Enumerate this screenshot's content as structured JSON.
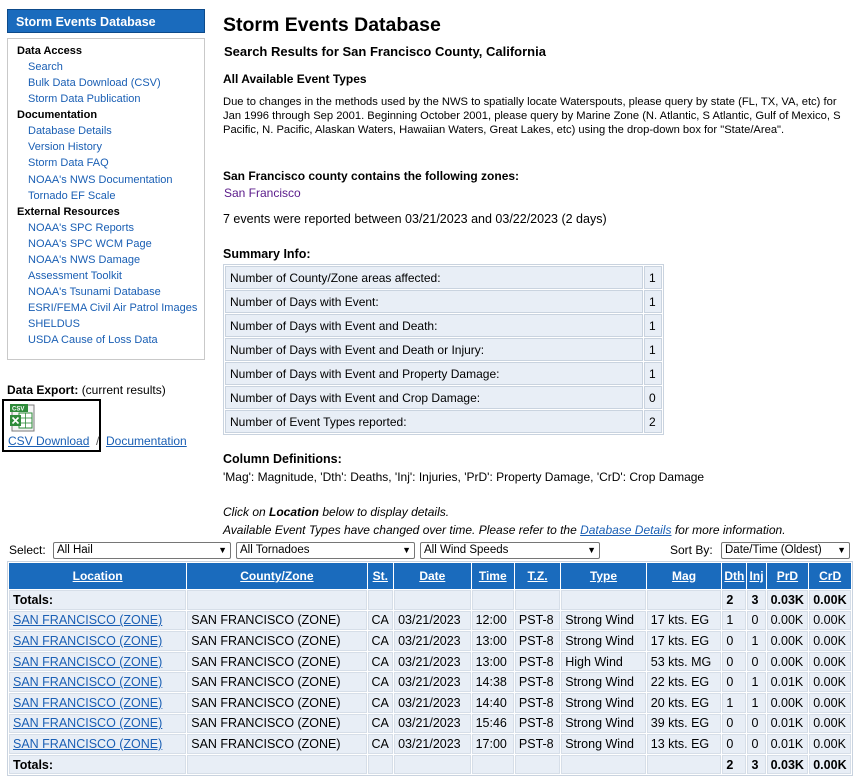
{
  "sidebar": {
    "header": "Storm Events Database",
    "sections": [
      {
        "title": "Data Access",
        "links": [
          "Search",
          "Bulk Data Download (CSV)",
          "Storm Data Publication"
        ]
      },
      {
        "title": "Documentation",
        "links": [
          "Database Details",
          "Version History",
          "Storm Data FAQ",
          "NOAA's NWS Documentation",
          "Tornado EF Scale"
        ]
      },
      {
        "title": "External Resources",
        "links": [
          "NOAA's SPC Reports",
          "NOAA's SPC WCM Page",
          "NOAA's NWS Damage",
          "Assessment Toolkit",
          "NOAA's Tsunami Database",
          "ESRI/FEMA Civil Air Patrol Images",
          "SHELDUS",
          "USDA Cause of Loss Data"
        ]
      }
    ]
  },
  "export": {
    "label": "Data Export:",
    "note": "(current results)",
    "icon_text": "CSV",
    "csv_link": "CSV Download",
    "separator": "/",
    "doc_link": "Documentation"
  },
  "main": {
    "title": "Storm Events Database",
    "subtitle": "Search Results for San Francisco County, California",
    "all_types": "All Available Event Types",
    "notice": "Due to changes in the methods used by the NWS to spatially locate Waterspouts, please query by state (FL, TX, VA, etc) for Jan 1996 through Sep 2001. Beginning October 2001, please query by Marine Zone (N. Atlantic, S Atlantic, Gulf of Mexico, S Pacific, N. Pacific, Alaskan Waters, Hawaiian Waters, Great Lakes, etc) using the drop-down box for \"State/Area\".",
    "zones_label": "San Francisco county contains the following zones:",
    "zone_name": "San Francisco",
    "events_line": "7 events were reported between 03/21/2023 and 03/22/2023 (2 days)",
    "summary_label": "Summary Info:",
    "summary": [
      {
        "label": "Number of County/Zone areas affected:",
        "value": "1"
      },
      {
        "label": "Number of Days with Event:",
        "value": "1"
      },
      {
        "label": "Number of Days with Event and Death:",
        "value": "1"
      },
      {
        "label": "Number of Days with Event and Death or Injury:",
        "value": "1"
      },
      {
        "label": "Number of Days with Event and Property Damage:",
        "value": "1"
      },
      {
        "label": "Number of Days with Event and Crop Damage:",
        "value": "0"
      },
      {
        "label": "Number of Event Types reported:",
        "value": "2"
      }
    ],
    "coldef_label": "Column Definitions:",
    "coldef_text": "'Mag': Magnitude, 'Dth': Deaths, 'Inj': Injuries, 'PrD': Property Damage, 'CrD': Crop Damage",
    "hint1_a": "Click on ",
    "hint1_b": "Location",
    "hint1_c": " below to display details.",
    "hint2_a": "Available Event Types have changed over time. Please refer to the ",
    "hint2_link": "Database Details",
    "hint2_c": " for more information."
  },
  "filters": {
    "select_label": "Select:",
    "hail": "All Hail",
    "tornado": "All Tornadoes",
    "wind": "All Wind Speeds",
    "sort_label": "Sort By:",
    "sort": "Date/Time (Oldest)"
  },
  "table": {
    "headers": [
      "Location",
      "County/Zone",
      "St.",
      "Date",
      "Time",
      "T.Z.",
      "Type",
      "Mag",
      "Dth",
      "Inj",
      "PrD",
      "CrD"
    ],
    "totals_label": "Totals:",
    "totals": {
      "dth": "2",
      "inj": "3",
      "prd": "0.03K",
      "crd": "0.00K"
    },
    "rows": [
      {
        "location": "SAN FRANCISCO (ZONE)",
        "county": "SAN FRANCISCO (ZONE)",
        "st": "CA",
        "date": "03/21/2023",
        "time": "12:00",
        "tz": "PST-8",
        "type": "Strong Wind",
        "mag": "17 kts. EG",
        "dth": "1",
        "inj": "0",
        "prd": "0.00K",
        "crd": "0.00K"
      },
      {
        "location": "SAN FRANCISCO (ZONE)",
        "county": "SAN FRANCISCO (ZONE)",
        "st": "CA",
        "date": "03/21/2023",
        "time": "13:00",
        "tz": "PST-8",
        "type": "Strong Wind",
        "mag": "17 kts. EG",
        "dth": "0",
        "inj": "1",
        "prd": "0.00K",
        "crd": "0.00K"
      },
      {
        "location": "SAN FRANCISCO (ZONE)",
        "county": "SAN FRANCISCO (ZONE)",
        "st": "CA",
        "date": "03/21/2023",
        "time": "13:00",
        "tz": "PST-8",
        "type": "High Wind",
        "mag": "53 kts. MG",
        "dth": "0",
        "inj": "0",
        "prd": "0.00K",
        "crd": "0.00K"
      },
      {
        "location": "SAN FRANCISCO (ZONE)",
        "county": "SAN FRANCISCO (ZONE)",
        "st": "CA",
        "date": "03/21/2023",
        "time": "14:38",
        "tz": "PST-8",
        "type": "Strong Wind",
        "mag": "22 kts. EG",
        "dth": "0",
        "inj": "1",
        "prd": "0.01K",
        "crd": "0.00K"
      },
      {
        "location": "SAN FRANCISCO (ZONE)",
        "county": "SAN FRANCISCO (ZONE)",
        "st": "CA",
        "date": "03/21/2023",
        "time": "14:40",
        "tz": "PST-8",
        "type": "Strong Wind",
        "mag": "20 kts. EG",
        "dth": "1",
        "inj": "1",
        "prd": "0.00K",
        "crd": "0.00K"
      },
      {
        "location": "SAN FRANCISCO (ZONE)",
        "county": "SAN FRANCISCO (ZONE)",
        "st": "CA",
        "date": "03/21/2023",
        "time": "15:46",
        "tz": "PST-8",
        "type": "Strong Wind",
        "mag": "39 kts. EG",
        "dth": "0",
        "inj": "0",
        "prd": "0.01K",
        "crd": "0.00K"
      },
      {
        "location": "SAN FRANCISCO (ZONE)",
        "county": "SAN FRANCISCO (ZONE)",
        "st": "CA",
        "date": "03/21/2023",
        "time": "17:00",
        "tz": "PST-8",
        "type": "Strong Wind",
        "mag": "13 kts. EG",
        "dth": "0",
        "inj": "0",
        "prd": "0.01K",
        "crd": "0.00K"
      }
    ]
  },
  "colors": {
    "header_blue": "#1a6bbd",
    "link": "#1a5fb4",
    "cell_bg": "#e8eef6",
    "zone_purple": "#5a1a8a"
  }
}
